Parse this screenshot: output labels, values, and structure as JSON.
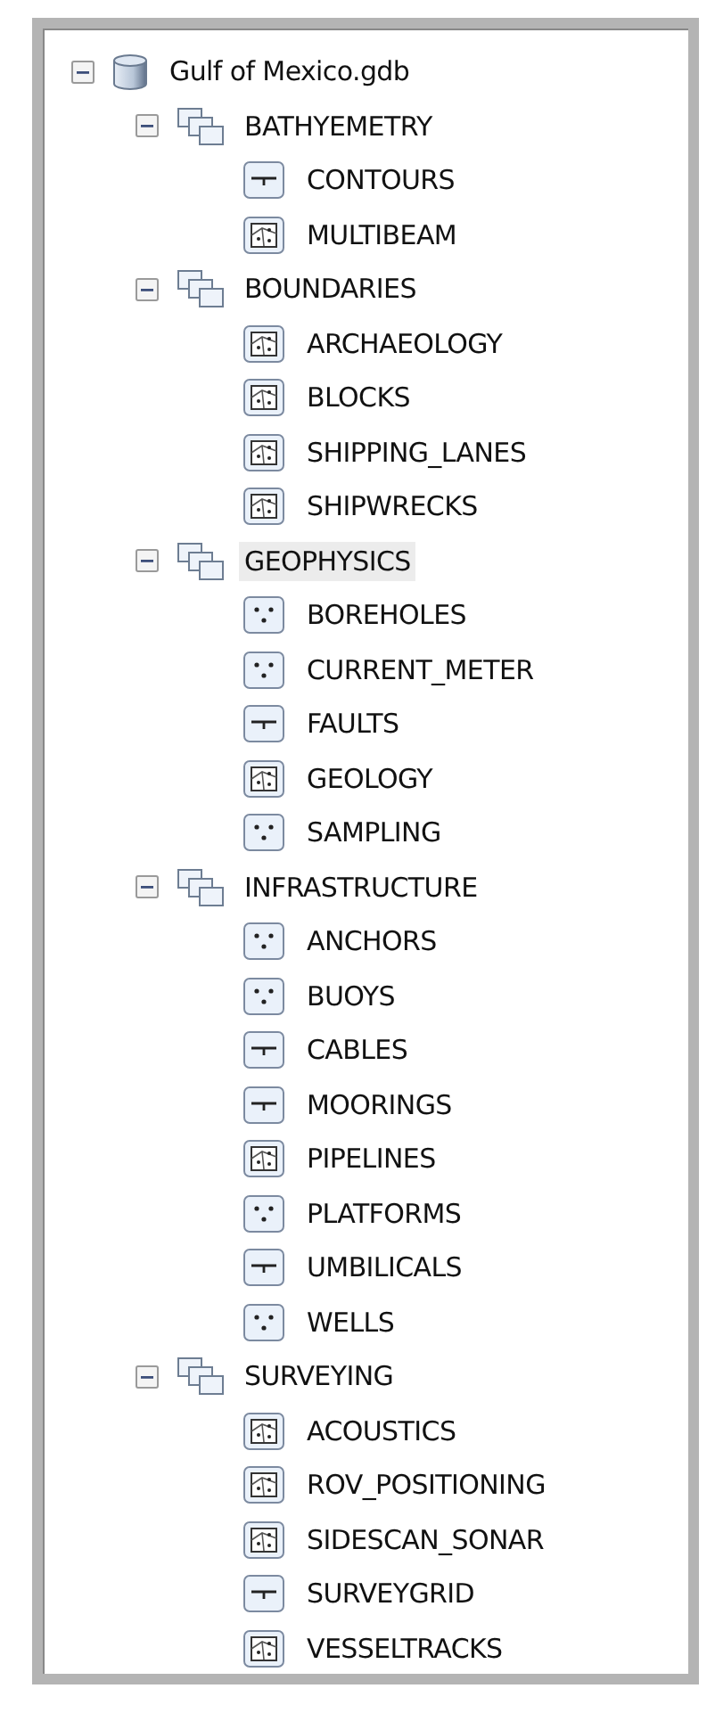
{
  "tree": {
    "label": "Gulf of Mexico.gdb",
    "expanded": true,
    "selected": false,
    "children": [
      {
        "label": "BATHYEMETRY",
        "expanded": true,
        "selected": false,
        "children": [
          {
            "label": "CONTOURS",
            "kind": "line",
            "selected": false
          },
          {
            "label": "MULTIBEAM",
            "kind": "polygon",
            "selected": false
          }
        ]
      },
      {
        "label": "BOUNDARIES",
        "expanded": true,
        "selected": false,
        "children": [
          {
            "label": "ARCHAEOLOGY",
            "kind": "polygon",
            "selected": false
          },
          {
            "label": "BLOCKS",
            "kind": "polygon",
            "selected": false
          },
          {
            "label": "SHIPPING_LANES",
            "kind": "polygon",
            "selected": false
          },
          {
            "label": "SHIPWRECKS",
            "kind": "polygon",
            "selected": false
          }
        ]
      },
      {
        "label": "GEOPHYSICS",
        "expanded": true,
        "selected": true,
        "children": [
          {
            "label": "BOREHOLES",
            "kind": "point",
            "selected": false
          },
          {
            "label": "CURRENT_METER",
            "kind": "point",
            "selected": false
          },
          {
            "label": "FAULTS",
            "kind": "line",
            "selected": false
          },
          {
            "label": "GEOLOGY",
            "kind": "polygon",
            "selected": false
          },
          {
            "label": "SAMPLING",
            "kind": "point",
            "selected": false
          }
        ]
      },
      {
        "label": "INFRASTRUCTURE",
        "expanded": true,
        "selected": false,
        "children": [
          {
            "label": "ANCHORS",
            "kind": "point",
            "selected": false
          },
          {
            "label": "BUOYS",
            "kind": "point",
            "selected": false
          },
          {
            "label": "CABLES",
            "kind": "line",
            "selected": false
          },
          {
            "label": "MOORINGS",
            "kind": "line",
            "selected": false
          },
          {
            "label": "PIPELINES",
            "kind": "polygon",
            "selected": false
          },
          {
            "label": "PLATFORMS",
            "kind": "point",
            "selected": false
          },
          {
            "label": "UMBILICALS",
            "kind": "line",
            "selected": false
          },
          {
            "label": "WELLS",
            "kind": "point",
            "selected": false
          }
        ]
      },
      {
        "label": "SURVEYING",
        "expanded": true,
        "selected": false,
        "children": [
          {
            "label": "ACOUSTICS",
            "kind": "polygon",
            "selected": false
          },
          {
            "label": "ROV_POSITIONING",
            "kind": "polygon",
            "selected": false
          },
          {
            "label": "SIDESCAN_SONAR",
            "kind": "polygon",
            "selected": false
          },
          {
            "label": "SURVEYGRID",
            "kind": "line",
            "selected": false
          },
          {
            "label": "VESSELTRACKS",
            "kind": "polygon",
            "selected": false
          }
        ]
      }
    ]
  }
}
